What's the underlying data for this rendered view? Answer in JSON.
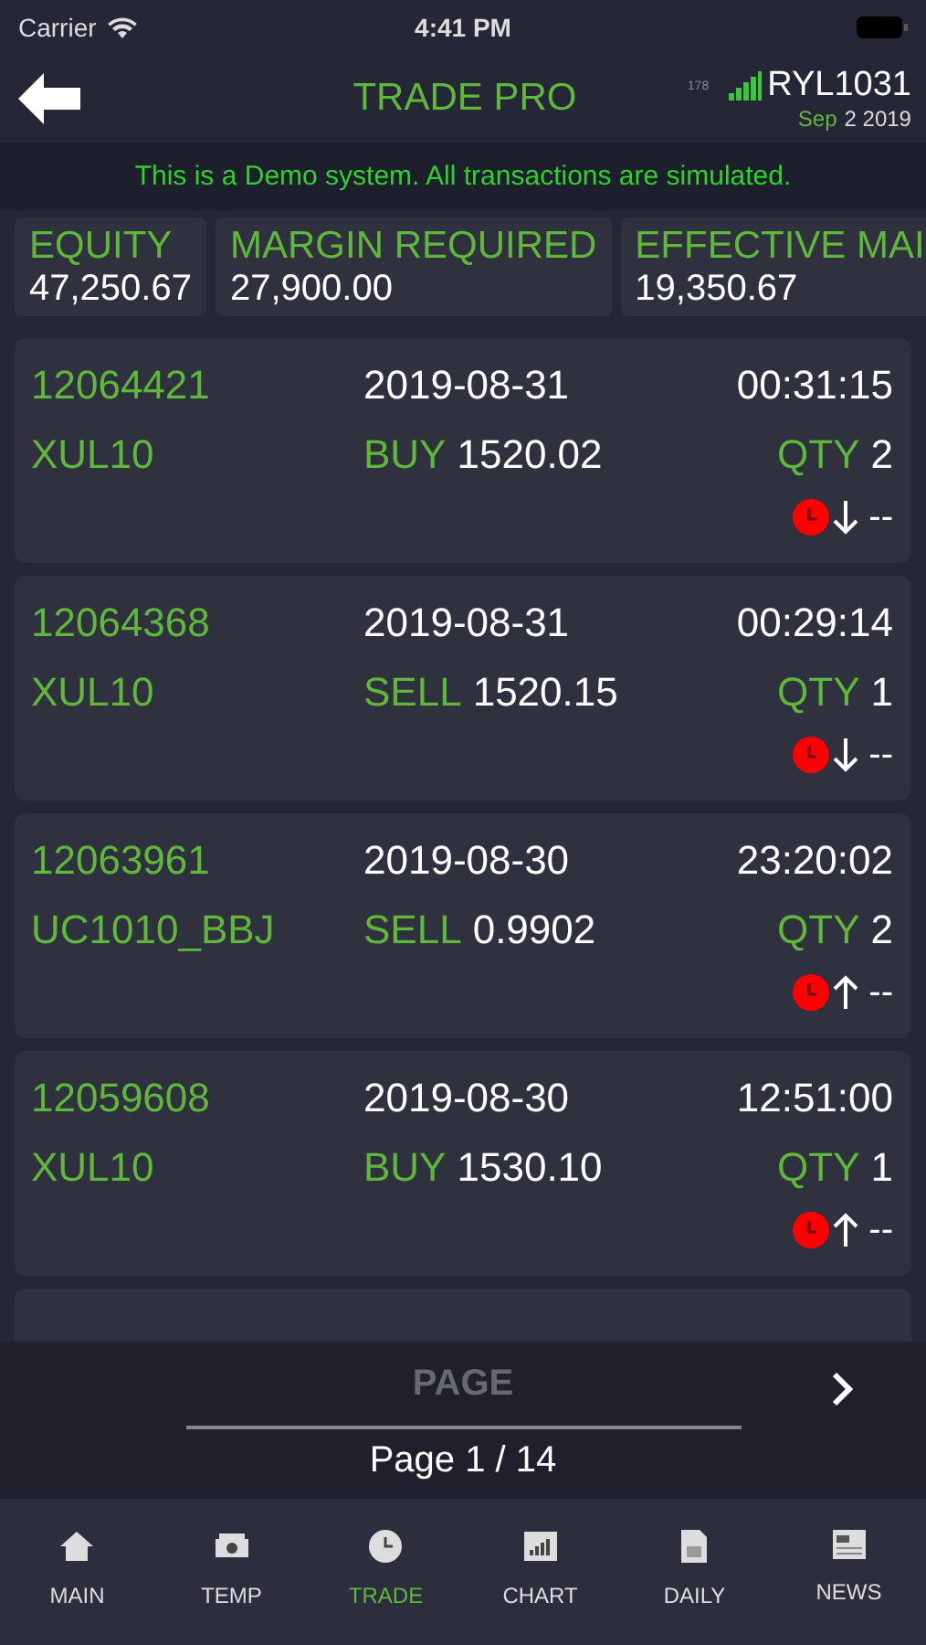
{
  "status_bar": {
    "carrier": "Carrier",
    "time": "4:41 PM"
  },
  "header": {
    "title": "TRADE PRO",
    "signal_value": "178",
    "account": "RYL1031",
    "date_month": "Sep",
    "date_rest": "2 2019"
  },
  "banner": "This is a Demo system. All transactions are simulated.",
  "summary": [
    {
      "label": "EQUITY",
      "value": "47,250.67"
    },
    {
      "label": "MARGIN REQUIRED",
      "value": "27,900.00"
    },
    {
      "label": "EFFECTIVE MAI",
      "value": "19,350.67"
    }
  ],
  "trades": [
    {
      "id": "12064421",
      "date": "2019-08-31",
      "time": "00:31:15",
      "symbol": "XUL10",
      "side": "BUY",
      "price": "1520.02",
      "qty_label": "QTY",
      "qty": "2",
      "kind": "down",
      "change": "--"
    },
    {
      "id": "12064368",
      "date": "2019-08-31",
      "time": "00:29:14",
      "symbol": "XUL10",
      "side": "SELL",
      "price": "1520.15",
      "qty_label": "QTY",
      "qty": "1",
      "kind": "down",
      "change": "--"
    },
    {
      "id": "12063961",
      "date": "2019-08-30",
      "time": "23:20:02",
      "symbol": "UC1010_BBJ",
      "side": "SELL",
      "price": "0.9902",
      "qty_label": "QTY",
      "qty": "2",
      "kind": "up",
      "change": "--"
    },
    {
      "id": "12059608",
      "date": "2019-08-30",
      "time": "12:51:00",
      "symbol": "XUL10",
      "side": "BUY",
      "price": "1530.10",
      "qty_label": "QTY",
      "qty": "1",
      "kind": "up",
      "change": "--"
    }
  ],
  "pagination": {
    "label": "PAGE",
    "page_text": "Page 1 / 14"
  },
  "tab_bar": [
    {
      "label": "MAIN",
      "selected": false
    },
    {
      "label": "TEMP",
      "selected": false
    },
    {
      "label": "TRADE",
      "selected": true
    },
    {
      "label": "CHART",
      "selected": false
    },
    {
      "label": "DAILY",
      "selected": false
    },
    {
      "label": "NEWS",
      "selected": false
    }
  ]
}
